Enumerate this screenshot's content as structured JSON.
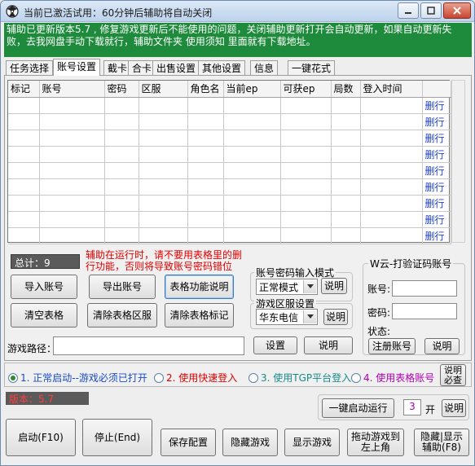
{
  "window": {
    "title": "当前已激活试用：60分钟后辅助将自动关闭"
  },
  "notice": "辅助已更新版本5.7 , 修复游戏更新后不能使用的问题，关闭辅助更新打开会自动更新，如果自动更新失败，去我网盘手动下载就行，辅助文件夹 使用须知 里面就有下载地址。",
  "tabs": [
    "任务选择",
    "账号设置",
    "截卡",
    "合卡",
    "出售设置",
    "其他设置",
    "信息",
    "一键花式"
  ],
  "active_tab": "账号设置",
  "table": {
    "headers": [
      "标记",
      "账号",
      "密码",
      "区服",
      "角色名",
      "当前ep",
      "可获ep",
      "局数",
      "登入时间",
      ""
    ],
    "row_action": "删行",
    "row_count": 9
  },
  "total_label": "总计：9",
  "warning": "辅助在运行时，请不要用表格里的删行功能，否则将导致账号密码错位",
  "buttons": {
    "import": "导入账号",
    "export": "导出账号",
    "table_help": "表格功能说明",
    "clear_table": "清空表格",
    "clear_region": "清除表格区服",
    "clear_mark": "清除表格标记",
    "set_path": "设置",
    "path_help": "说明",
    "register": "注册账号",
    "captcha_help": "说明",
    "mode_help": "说明",
    "region_help": "说明",
    "start_mode_help": "说明必查",
    "one_click_start": "一键启动运行",
    "one_click_help": "说明",
    "start": "启动(F10)",
    "stop": "停止(End)",
    "save": "保存配置",
    "hide_game": "隐藏游戏",
    "show_game": "显示游戏",
    "move_game": "拖动游戏到左上角",
    "hide_show_aux": "隐藏|显示辅助(F8)"
  },
  "input_mode": {
    "title": "账号密码输入模式",
    "value": "正常模式"
  },
  "region": {
    "title": "游戏区服设置",
    "value": "华东电信"
  },
  "captcha": {
    "title": "W云-打验证码账号",
    "account_label": "账号:",
    "password_label": "密码:",
    "status_label": "状态:"
  },
  "game_path_label": "游戏路径：",
  "start_modes": [
    {
      "label": "1. 正常启动--游戏必须已打开",
      "color": "#1a4cc8",
      "selected": true
    },
    {
      "label": "2. 使用快速登入",
      "color": "#e00000",
      "selected": false
    },
    {
      "label": "3. 使用TGP平台登入",
      "color": "#178a8a",
      "selected": false
    },
    {
      "label": "4. 使用表格账号",
      "color": "#b000b0",
      "selected": false
    }
  ],
  "version_label": "版本：5.7",
  "launch_count": "3",
  "launch_unit": "开",
  "colors": {
    "notice_bg": "#1e8a3c",
    "warning": "#e00000",
    "delete_link": "#1f3fc8"
  }
}
